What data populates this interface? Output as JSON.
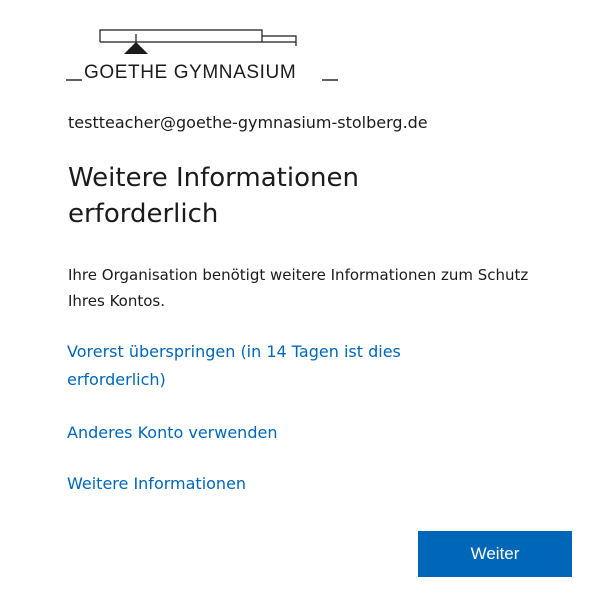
{
  "brand": {
    "logo_text": "GOETHE GYMNASIUM",
    "color_text": "#1b1b1b"
  },
  "identity": {
    "email": "testteacher@goethe-gymnasium-stolberg.de"
  },
  "page": {
    "title": "Weitere Informationen erforderlich",
    "description": "Ihre Organisation benötigt weitere Informationen zum Schutz Ihres Kontos."
  },
  "links": {
    "skip": "Vorerst überspringen (in 14 Tagen ist dies erforderlich)",
    "other_account": "Anderes Konto verwenden",
    "more_info": "Weitere Informationen"
  },
  "actions": {
    "next_label": "Weiter"
  },
  "colors": {
    "accent": "#0067b8",
    "link": "#0067b8",
    "background": "#ffffff"
  }
}
